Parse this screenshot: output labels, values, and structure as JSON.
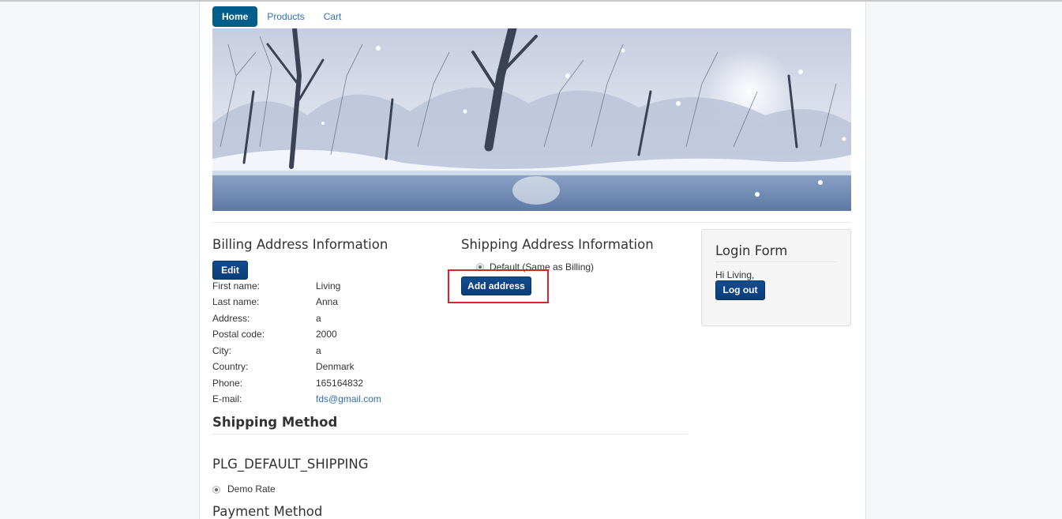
{
  "nav": {
    "tabs": [
      {
        "label": "Home",
        "active": true
      },
      {
        "label": "Products",
        "active": false
      },
      {
        "label": "Cart",
        "active": false
      }
    ]
  },
  "banner": {
    "alt": "winter-landscape-banner"
  },
  "billing": {
    "title": "Billing Address Information",
    "edit_label": "Edit",
    "fields": [
      {
        "label": "First name:",
        "value": "Living"
      },
      {
        "label": "Last name:",
        "value": "Anna"
      },
      {
        "label": "Address:",
        "value": "a"
      },
      {
        "label": "Postal code:",
        "value": "2000"
      },
      {
        "label": "City:",
        "value": "a"
      },
      {
        "label": "Country:",
        "value": "Denmark"
      },
      {
        "label": "Phone:",
        "value": "165164832"
      },
      {
        "label": "E-mail:",
        "value": "fds@gmail.com"
      }
    ]
  },
  "shipping_address": {
    "title": "Shipping Address Information",
    "default_option": "Default (Same as Billing)",
    "add_address_label": "Add address"
  },
  "shipping_method": {
    "title": "Shipping Method",
    "plugin_name": "PLG_DEFAULT_SHIPPING",
    "rate_option": "Demo Rate"
  },
  "payment_method": {
    "title": "Payment Method"
  },
  "login": {
    "title": "Login Form",
    "greeting": "Hi Living,",
    "logout_label": "Log out"
  },
  "colors": {
    "accent": "#005e8d",
    "button": "#0b3d7a",
    "link": "#2f6eb5",
    "highlight": "#d9262c"
  }
}
